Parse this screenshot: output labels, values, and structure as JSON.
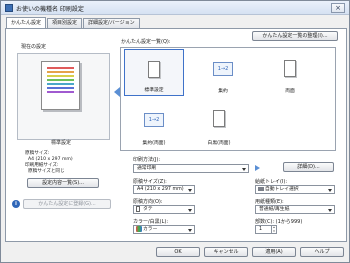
{
  "window": {
    "title": "お使いの機種名 印刷設定",
    "close_glyph": "×"
  },
  "tabs": [
    {
      "label": "かんたん設定"
    },
    {
      "label": "項目別設定"
    },
    {
      "label": "詳細設定/バージョン"
    }
  ],
  "left": {
    "current_settings_label": "現在の設定",
    "preset_name": "標準設定",
    "paper_size_label": "原稿サイズ:",
    "paper_size_value": "A4 (210 x 297 mm)",
    "print_size_label": "印刷用紙サイズ:",
    "print_size_value": "原稿サイズと同じ",
    "details_button": "設定内容一覧(S)...",
    "register_button": "かんたん設定に登録(G)..."
  },
  "presets": {
    "list_label": "かんたん設定一覧(Q):",
    "manage_button": "かんたん設定一覧の整理(I)...",
    "items": [
      {
        "label": "標準設定",
        "icon": "document-icon"
      },
      {
        "label": "集約",
        "icon": "n-up-icon",
        "glyph": "1→2"
      },
      {
        "label": "両面",
        "icon": "document-icon"
      },
      {
        "label": "集約(両面)",
        "icon": "n-up-icon",
        "glyph": "1→2"
      },
      {
        "label": "白黒(両面)",
        "icon": "document-icon"
      }
    ]
  },
  "form": {
    "print_method_label": "印刷方法(J):",
    "print_method_value": "通常印刷",
    "detail_button": "詳細(D)...",
    "paper_size_label": "原稿サイズ(Z):",
    "paper_size_value": "A4 (210 x 297 mm)",
    "input_tray_label": "給紙トレイ(I):",
    "input_tray_value": "自動トレイ選択",
    "orientation_label": "原稿方向(O):",
    "orientation_value": "タテ",
    "paper_type_label": "用紙種類(E):",
    "paper_type_value": "普通紙/再生紙",
    "color_label": "カラー/白黒(L):",
    "color_value": "カラー",
    "copies_label": "部数(C): (1から999)",
    "copies_value": "1"
  },
  "footer": {
    "ok": "OK",
    "cancel": "キャンセル",
    "apply": "適用(A)",
    "help": "ヘルプ"
  },
  "colors": {
    "accent": "#3f72c9",
    "arrow": "#5b8fd4"
  }
}
